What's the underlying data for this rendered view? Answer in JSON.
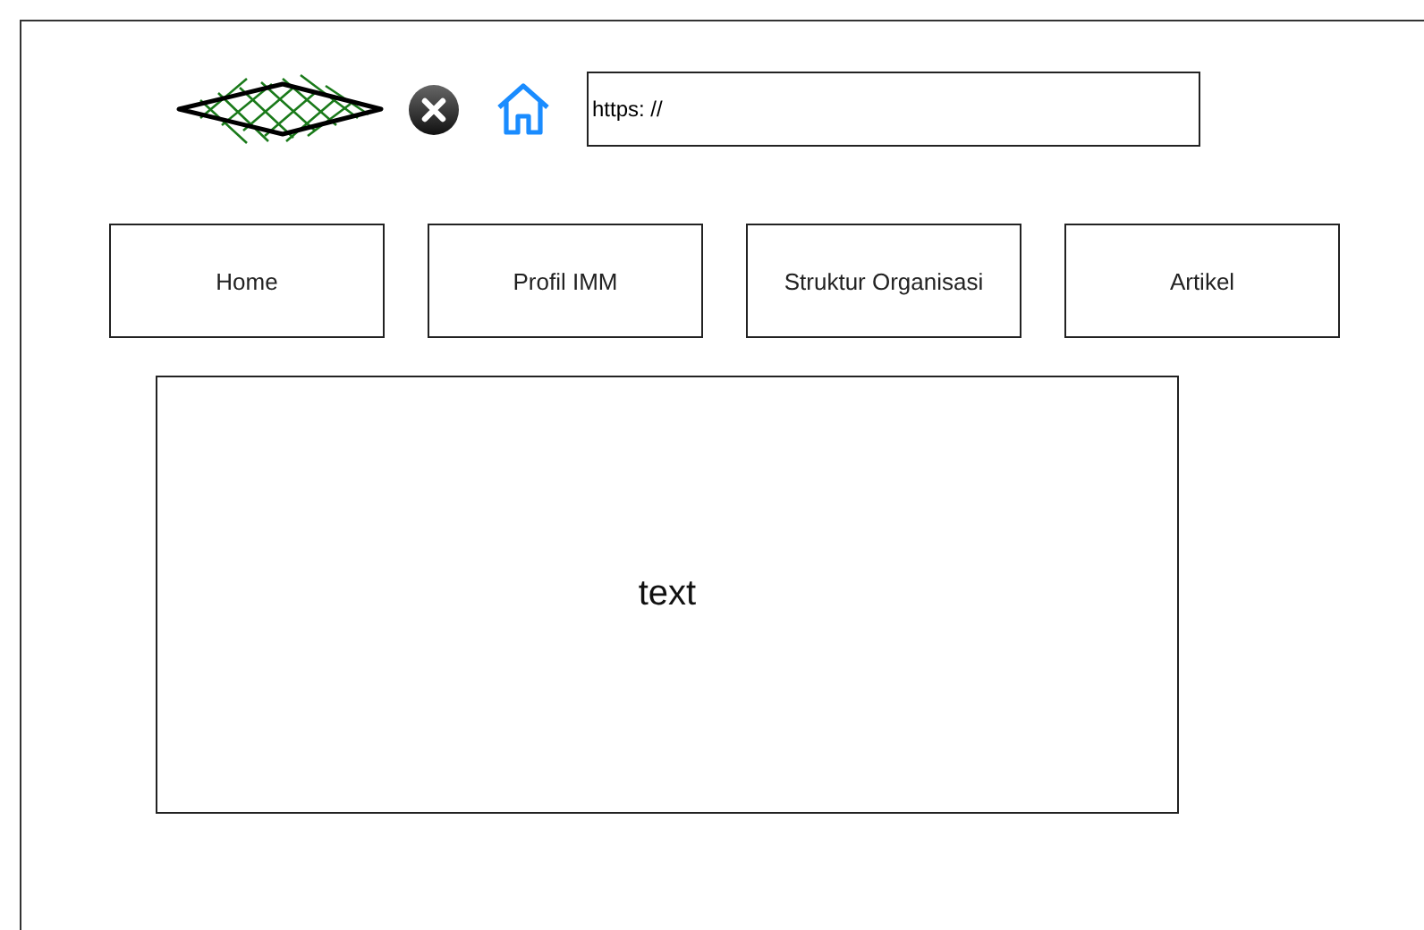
{
  "address_bar": {
    "value": "https: //"
  },
  "nav": [
    {
      "label": "Home"
    },
    {
      "label": "Profil IMM"
    },
    {
      "label": "Struktur Organisasi"
    },
    {
      "label": "Artikel"
    }
  ],
  "content": {
    "text": "text"
  }
}
